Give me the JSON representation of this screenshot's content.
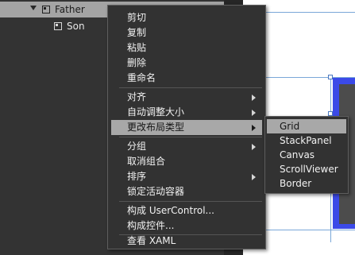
{
  "tree": {
    "rows": [
      {
        "label": "Father",
        "icon": "grid-icon",
        "expanded": true,
        "selected": true
      },
      {
        "label": "Son",
        "icon": "grid-icon",
        "selected": false
      }
    ]
  },
  "context_menu": {
    "items": [
      {
        "label": "剪切"
      },
      {
        "label": "复制"
      },
      {
        "label": "粘贴"
      },
      {
        "label": "删除"
      },
      {
        "label": "重命名"
      },
      {
        "label": "对齐",
        "has_submenu": true
      },
      {
        "label": "自动调整大小",
        "has_submenu": true
      },
      {
        "label": "更改布局类型",
        "has_submenu": true,
        "highlighted": true
      },
      {
        "label": "分组",
        "has_submenu": true
      },
      {
        "label": "取消组合"
      },
      {
        "label": "排序",
        "has_submenu": true
      },
      {
        "label": "锁定活动容器"
      },
      {
        "label": "构成 UserControl..."
      },
      {
        "label": "构成控件..."
      },
      {
        "label": "查看 XAML"
      }
    ]
  },
  "submenu": {
    "items": [
      {
        "label": "Grid",
        "highlighted": true
      },
      {
        "label": "StackPanel"
      },
      {
        "label": "Canvas"
      },
      {
        "label": "ScrollViewer"
      },
      {
        "label": "Border"
      }
    ]
  },
  "colors": {
    "menu_background": "#323232",
    "highlight": "#a8a8a8",
    "selection_accent": "#3b4ae8"
  }
}
